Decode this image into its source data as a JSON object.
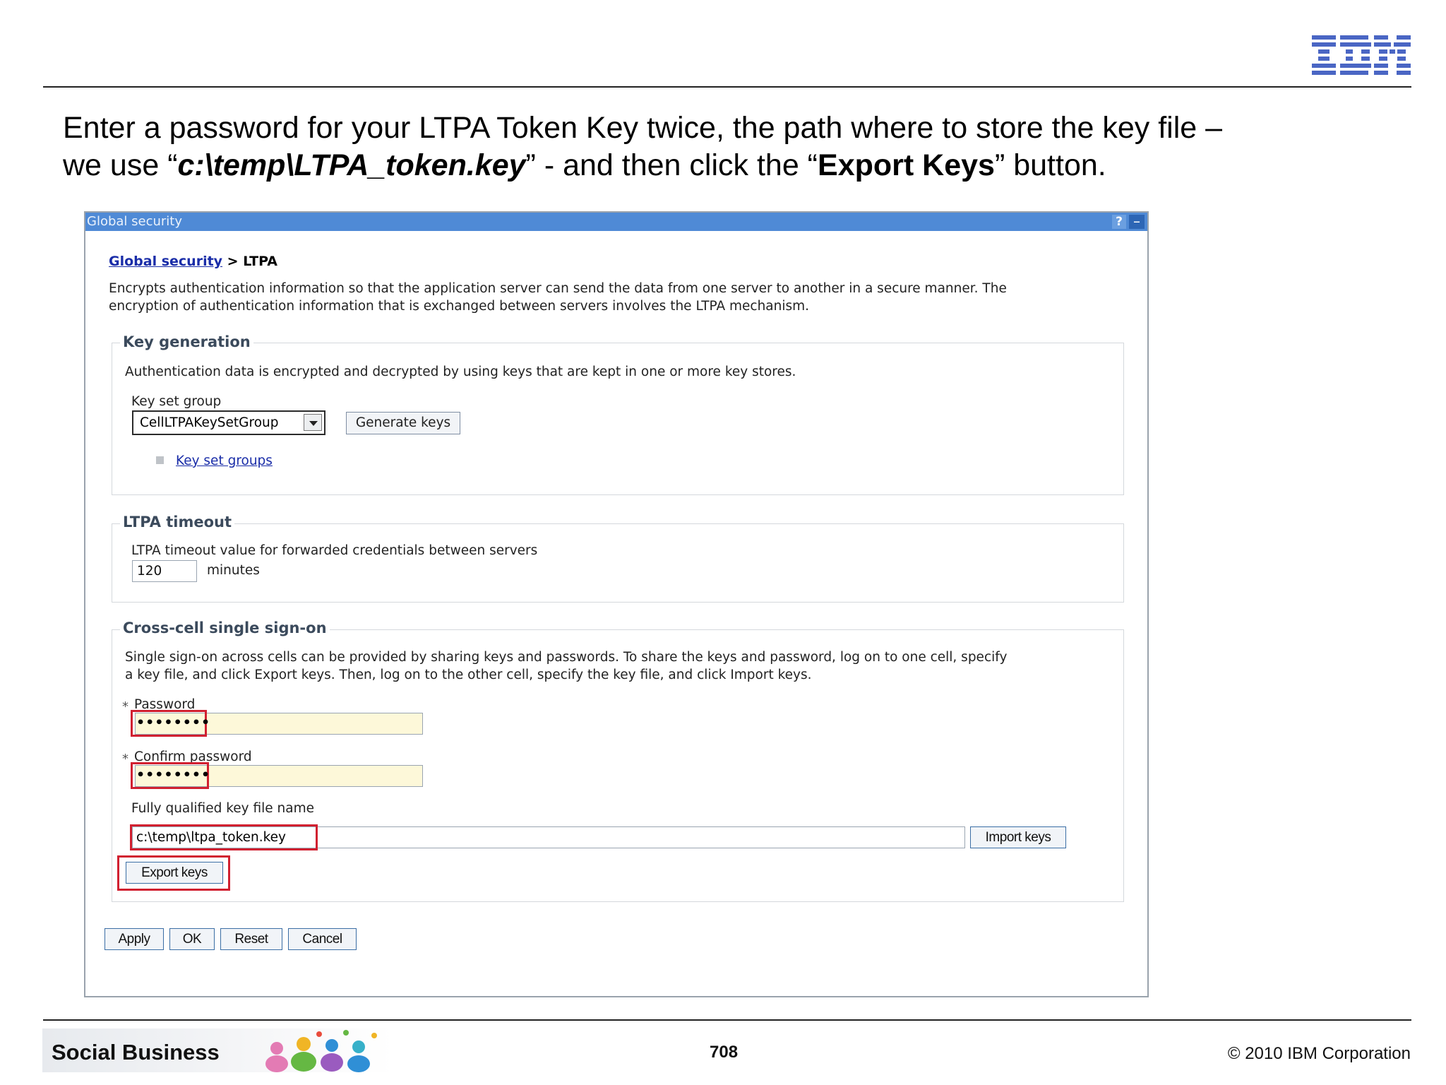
{
  "slide": {
    "instruction_line1": "Enter a password for your LTPA Token Key twice, the path where to store the key file –",
    "instruction_line2_pre": "we use “",
    "instruction_path": "c:\\temp\\LTPA_token.key",
    "instruction_line2_mid": "” - and then click the “",
    "instruction_button": "Export Keys",
    "instruction_line2_post": "” button.",
    "footer_brand": "Social Business",
    "page_number": "708",
    "copyright": "© 2010 IBM Corporation",
    "logo_text": "IBM"
  },
  "panel": {
    "title": "Global security",
    "help_label": "?",
    "minimize_label": "–",
    "breadcrumb_link": "Global security",
    "breadcrumb_sep": " > ",
    "breadcrumb_current": "LTPA",
    "description_line1": "Encrypts authentication information so that the application server can send the data from one server to another in a secure manner. The",
    "description_line2": "encryption of authentication information that is exchanged between servers involves the LTPA mechanism."
  },
  "key_generation": {
    "legend": "Key generation",
    "description": "Authentication data is encrypted and decrypted by using keys that are kept in one or more key stores.",
    "key_set_group_label": "Key set group",
    "key_set_group_value": "CellLTPAKeySetGroup",
    "generate_keys_label": "Generate keys",
    "key_set_groups_link": "Key set groups"
  },
  "ltpa_timeout": {
    "legend": "LTPA timeout",
    "description": "LTPA timeout value for forwarded credentials between servers",
    "value": "120",
    "unit": "minutes"
  },
  "cross_cell": {
    "legend": "Cross-cell single sign-on",
    "description_line1": "Single sign-on across cells can be provided by sharing keys and passwords. To share the keys and password, log on to one cell, specify",
    "description_line2": "a key file, and click Export keys. Then, log on to the other cell, specify the key file, and click Import keys.",
    "required_marker": "*",
    "password_label": "Password",
    "password_value": "••••••••",
    "confirm_password_label": "Confirm password",
    "confirm_password_value": "••••••••",
    "key_file_label": "Fully qualified key file name",
    "key_file_value": "c:\\temp\\ltpa_token.key",
    "import_keys_label": "Import keys",
    "export_keys_label": "Export keys"
  },
  "actions": {
    "apply": "Apply",
    "ok": "OK",
    "reset": "Reset",
    "cancel": "Cancel"
  },
  "colors": {
    "title_bar": "#4f8ad6",
    "highlight": "#d12030",
    "required_field_bg": "#fdf8d9",
    "ibm_blue": "#3d5fb5"
  }
}
